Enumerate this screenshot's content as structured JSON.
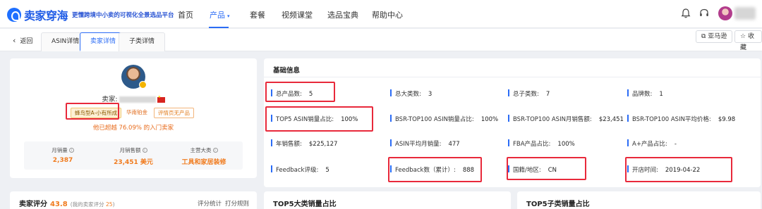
{
  "header": {
    "logo_text": "卖家穿海",
    "slogan": "更懂跨境中小卖的可视化全景选品平台",
    "nav": [
      {
        "label": "首页"
      },
      {
        "label": "产品",
        "active": true
      },
      {
        "label": "套餐"
      },
      {
        "label": "视频课堂"
      },
      {
        "label": "选品宝典"
      },
      {
        "label": "帮助中心"
      }
    ],
    "icons": [
      "bell-icon",
      "headset-icon",
      "avatar"
    ]
  },
  "tabs_row": {
    "back_label": "返回",
    "tabs": [
      {
        "label": "ASIN详情"
      },
      {
        "label": "卖家详情",
        "active": true
      },
      {
        "label": "子类详情"
      }
    ],
    "amazon_button": "亚马逊",
    "favorite_button": "收藏"
  },
  "seller": {
    "seller_label": "卖家:",
    "tag1": "蜂鸟型A-小有所成",
    "tag2": "华南铂金",
    "tag3": "评情页无产品",
    "beat_text": "他已超越 76.09% 的入门卖家",
    "stats": [
      {
        "label": "月销量",
        "value": "2,387"
      },
      {
        "label": "月销售额",
        "value": "23,451 美元"
      },
      {
        "label": "主营大类",
        "value": "工具和家居装修"
      }
    ]
  },
  "basic_info": {
    "title": "基础信息",
    "rows": [
      [
        {
          "label": "总产品数:",
          "value": "5"
        },
        {
          "label": "总大类数:",
          "value": "3"
        },
        {
          "label": "总子类数:",
          "value": "7"
        },
        {
          "label": "品牌数:",
          "value": "1"
        }
      ],
      [
        {
          "label": "TOP5 ASIN销量占比:",
          "value": "100%"
        },
        {
          "label": "BSR-TOP100 ASIN销量占比:",
          "value": "100%"
        },
        {
          "label": "BSR-TOP100 ASIN月销售额:",
          "value": "$23,451"
        },
        {
          "label": "BSR-TOP100 ASIN平均价格:",
          "value": "$9.98"
        }
      ],
      [
        {
          "label": "年销售额:",
          "value": "$225,127"
        },
        {
          "label": "ASIN平均月销量:",
          "value": "477"
        },
        {
          "label": "FBA产品占比:",
          "value": "100%"
        },
        {
          "label": "A+产品占比:",
          "value": "-"
        }
      ],
      [
        {
          "label": "Feedback评级:",
          "value": "5"
        },
        {
          "label": "Feedback数（累计）:",
          "value": "888"
        },
        {
          "label": "国籍/地区:",
          "value": "CN"
        },
        {
          "label": "开店时间:",
          "value": "2019-04-22"
        }
      ]
    ]
  },
  "bottom": {
    "score_title": "卖家评分",
    "score_value": "43.8",
    "score_sub_prefix": "(我的卖家评分",
    "score_sub_value": "25",
    "score_sub_suffix": ")",
    "link1": "评分统计",
    "link2": "打分规则",
    "top5_major": "TOP5大类销量占比",
    "top5_sub": "TOP5子类销量占比"
  },
  "colors": {
    "primary": "#2b6cf5",
    "orange": "#f07b1e",
    "highlight": "#e8293b"
  }
}
